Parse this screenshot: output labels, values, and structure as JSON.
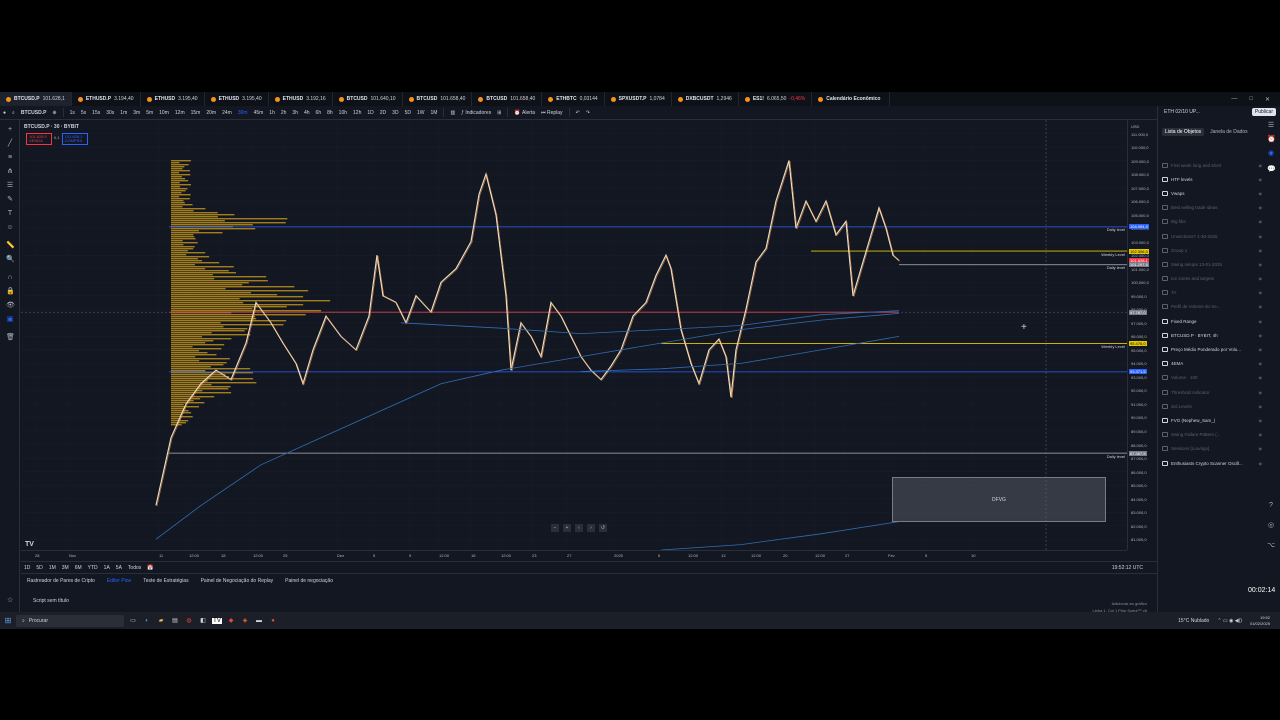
{
  "tabs": [
    {
      "symbol": "BTCUSD.P",
      "price": "101.628,1",
      "change": "",
      "active": true
    },
    {
      "symbol": "ETHUSD.P",
      "price": "3.194,40",
      "change": ""
    },
    {
      "symbol": "ETHUSD",
      "price": "3.195,40",
      "change": ""
    },
    {
      "symbol": "ETHUSD",
      "price": "3.195,40",
      "change": ""
    },
    {
      "symbol": "ETHUSD",
      "price": "3.192,16",
      "change": ""
    },
    {
      "symbol": "BTCUSD",
      "price": "101.640,10",
      "change": ""
    },
    {
      "symbol": "BTCUSD",
      "price": "101.658,40",
      "change": ""
    },
    {
      "symbol": "BTCUSD",
      "price": "101.658,40",
      "change": ""
    },
    {
      "symbol": "ETHBTC",
      "price": "0,03144",
      "change": ""
    },
    {
      "symbol": "SPXUSDT.P",
      "price": "1,0784",
      "change": ""
    },
    {
      "symbol": "DXBCUSDT",
      "price": "1,2946",
      "change": ""
    },
    {
      "symbol": "ES1!",
      "price": "6.065,50",
      "change": "-0,46%"
    },
    {
      "symbol": "Calendário Econômico",
      "price": "",
      "change": ""
    }
  ],
  "toolbar": {
    "symbol": "BTCUSD.P",
    "intervals": [
      "1s",
      "5s",
      "15s",
      "30s",
      "1m",
      "3m",
      "5m",
      "10m",
      "12m",
      "15m",
      "20m",
      "24m",
      "30m",
      "45m",
      "1h",
      "2h",
      "3h",
      "4h",
      "6h",
      "8h",
      "10h",
      "12h",
      "1D",
      "2D",
      "3D",
      "5D",
      "1W",
      "1M"
    ],
    "selected_interval": "30m",
    "indicators_label": "Indicadores",
    "alert_label": "Alerta",
    "replay_label": "Replay"
  },
  "legend": {
    "title": "BTCUSD.P · 30 · BYBIT",
    "sell_price": "101.628,0",
    "sell_label": "VENDA",
    "spread": "0,1",
    "buy_price": "101.628,1",
    "buy_label": "COMPRA"
  },
  "price_scale": {
    "currency": "USD",
    "labels": [
      "111.000,0",
      "110.000,0",
      "109.000,0",
      "108.000,0",
      "107.000,0",
      "106.000,0",
      "105.000,0",
      "104.000,0",
      "103.000,0",
      "102.000,0",
      "101.000,0",
      "100.000,0",
      "99.000,0",
      "98.000,0",
      "97.000,0",
      "96.000,0",
      "95.000,0",
      "94.000,0",
      "93.000,0",
      "92.000,0",
      "91.000,0",
      "90.000,0",
      "89.000,0",
      "88.000,0",
      "87.000,0",
      "86.000,0",
      "85.000,0",
      "84.000,0",
      "83.000,0",
      "82.000,0",
      "81.000,0"
    ],
    "tags": [
      {
        "text": "104.094,0",
        "value": 104094,
        "color": "#2962ff"
      },
      {
        "text": "102.306,0",
        "value": 102306,
        "color": "#e3c900"
      },
      {
        "text": "101.628,1",
        "value": 101628,
        "color": "#f23645"
      },
      {
        "text": "101.297,5",
        "value": 101297,
        "color": "#787b86"
      },
      {
        "text": "97.787,0",
        "value": 97787,
        "color": "#787b86"
      },
      {
        "text": "95.476,0",
        "value": 95476,
        "color": "#e3c900"
      },
      {
        "text": "93.371,5",
        "value": 93371,
        "color": "#2962ff"
      },
      {
        "text": "87.367,5",
        "value": 87367,
        "color": "#787b86"
      }
    ]
  },
  "levels": [
    {
      "label": "Daily level",
      "value": 104094
    },
    {
      "label": "Weekly Level",
      "value": 102306
    },
    {
      "label": "Daily level",
      "value": 101297
    },
    {
      "label": "Weekly Level",
      "value": 95476
    },
    {
      "label": "Daily level",
      "value": 87367
    }
  ],
  "box_label": "DFVG",
  "time_scale": [
    "28",
    "Nov",
    "11",
    "12:00",
    "18",
    "12:00",
    "25",
    "Dez",
    "5",
    "9",
    "12:00",
    "16",
    "12:00",
    "23",
    "27",
    "2025",
    "6",
    "12:00",
    "13",
    "12:00",
    "20",
    "12:00",
    "27",
    "Fev",
    "5",
    "10"
  ],
  "range_bar": {
    "ranges": [
      "1D",
      "5D",
      "1M",
      "3M",
      "6M",
      "YTD",
      "1A",
      "5A",
      "Todos"
    ],
    "utc": "19:52:12 UTC"
  },
  "bottom_panel": {
    "tabs": [
      "Rastreador de Pares de Cripto",
      "Editor Pine",
      "Teste de Estratégias",
      "Painel de Negociação do Replay",
      "Painel de negociação"
    ],
    "active_tab": "Editor Pine",
    "script_name": "Script sem título",
    "right_text": "Adicionar ao gráfico",
    "status": "Linha 1, Col 1   Pine Script™ v6"
  },
  "right_panel": {
    "header": "ETH 02/10 UP...",
    "publish": "Publicar",
    "tabs": [
      "Lista de Objetos",
      "Janela de Dados"
    ],
    "active_tab": "Lista de Objetos",
    "objects": [
      {
        "label": "First week long and short",
        "dim": true
      },
      {
        "label": "HTF levels",
        "dim": false
      },
      {
        "label": "Vwaps",
        "dim": false
      },
      {
        "label": "Best selling trade ideas",
        "dim": true
      },
      {
        "label": "Big fibs",
        "dim": true
      },
      {
        "label": "Unsections? 1-30-2025",
        "dim": true
      },
      {
        "label": "Group 1",
        "dim": true
      },
      {
        "label": "Swing setups 13-01-2025",
        "dim": true
      },
      {
        "label": "Ice zones and targets",
        "dim": true
      },
      {
        "label": "TA",
        "dim": true
      },
      {
        "label": "Perfil de Volume do Se...",
        "dim": true
      },
      {
        "label": "Fixed Range",
        "dim": false
      },
      {
        "label": "BTCUSD.P · BYBIT, 4h",
        "dim": false
      },
      {
        "label": "Preço Médio Ponderado por Volu...",
        "dim": false
      },
      {
        "label": "4EMA",
        "dim": false
      },
      {
        "label": "Volume · 100",
        "dim": true
      },
      {
        "label": "Threshold Indicator",
        "dim": true
      },
      {
        "label": "3rd Levels",
        "dim": true
      },
      {
        "label": "FVG (Nephew_Sam_)",
        "dim": false
      },
      {
        "label": "Swing Failure Pattern (...",
        "dim": true
      },
      {
        "label": "Sessions [LuxAlgo]",
        "dim": true
      },
      {
        "label": "Enthusiasts Crypto Scanner Oscill...",
        "dim": false
      }
    ]
  },
  "timer": "00:02:14",
  "taskbar": {
    "search": "Procurar",
    "weather": "15°C  Nublado",
    "time": "19:52",
    "date": "01/02/2025"
  }
}
